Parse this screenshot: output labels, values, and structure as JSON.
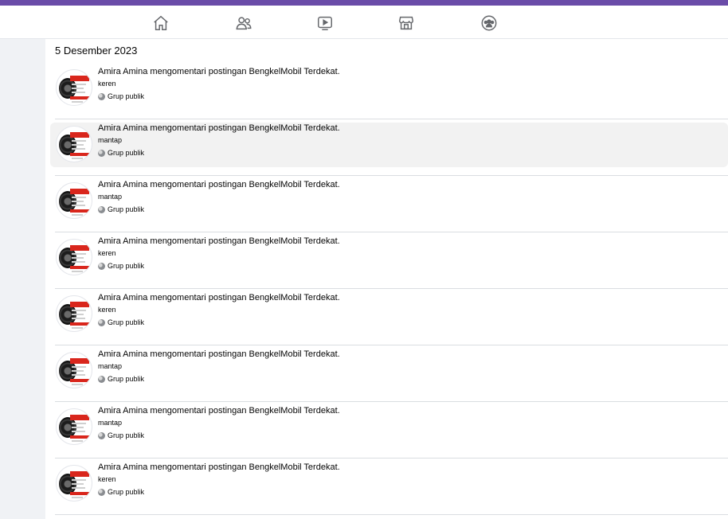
{
  "nav": {
    "items": [
      {
        "icon": "home-icon"
      },
      {
        "icon": "friends-icon"
      },
      {
        "icon": "watch-icon"
      },
      {
        "icon": "marketplace-icon"
      },
      {
        "icon": "groups-icon"
      }
    ]
  },
  "activity": {
    "date_heading": "5 Desember 2023",
    "entries": [
      {
        "title": "Amira Amina mengomentari postingan BengkelMobil Terdekat.",
        "comment": "keren",
        "privacy": "Grup publik"
      },
      {
        "title": "Amira Amina mengomentari postingan BengkelMobil Terdekat.",
        "comment": "mantap",
        "privacy": "Grup publik"
      },
      {
        "title": "Amira Amina mengomentari postingan BengkelMobil Terdekat.",
        "comment": "mantap",
        "privacy": "Grup publik"
      },
      {
        "title": "Amira Amina mengomentari postingan BengkelMobil Terdekat.",
        "comment": "keren",
        "privacy": "Grup publik"
      },
      {
        "title": "Amira Amina mengomentari postingan BengkelMobil Terdekat.",
        "comment": "keren",
        "privacy": "Grup publik"
      },
      {
        "title": "Amira Amina mengomentari postingan BengkelMobil Terdekat.",
        "comment": "mantap",
        "privacy": "Grup publik"
      },
      {
        "title": "Amira Amina mengomentari postingan BengkelMobil Terdekat.",
        "comment": "mantap",
        "privacy": "Grup publik"
      },
      {
        "title": "Amira Amina mengomentari postingan BengkelMobil Terdekat.",
        "comment": "keren",
        "privacy": "Grup publik"
      }
    ]
  },
  "colors": {
    "accent_bar": "#6a4ca8",
    "hover_row": "#f2f2f2",
    "rail": "#f0f2f5"
  }
}
